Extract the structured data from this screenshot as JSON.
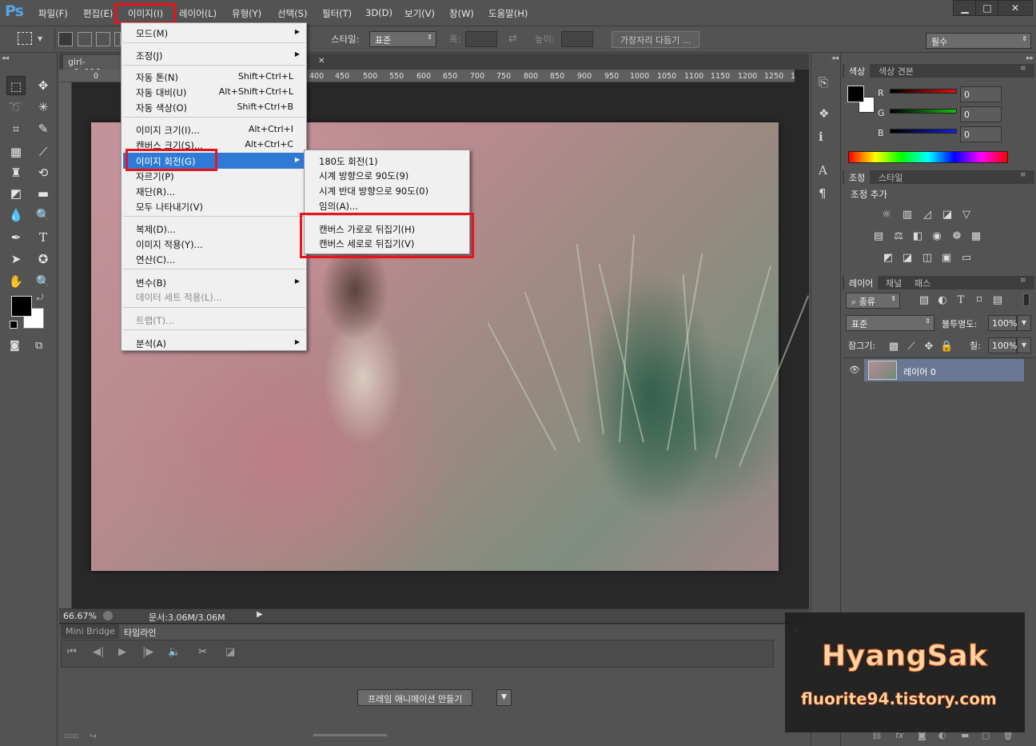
{
  "app": {
    "logo": "Ps"
  },
  "menubar": {
    "items": [
      "파일(F)",
      "편집(E)",
      "이미지(I)",
      "레이어(L)",
      "유형(Y)",
      "선택(S)",
      "필터(T)",
      "3D(D)",
      "보기(V)",
      "창(W)",
      "도움말(H)"
    ],
    "window_controls": [
      "minimize-icon",
      "maximize-icon",
      "close-icon"
    ]
  },
  "options": {
    "style_label": "스타일:",
    "style_value": "표준",
    "width_label": "폭:",
    "height_label": "높이:",
    "refine_button": "가장자리 다듬기 ...",
    "workspace": "필수"
  },
  "document": {
    "tab_title": "girl-g8c996e",
    "ruler_ticks": [
      "0",
      "400",
      "450",
      "500",
      "550",
      "600",
      "650",
      "700",
      "750",
      "800",
      "850",
      "900",
      "950",
      "1000",
      "1050",
      "1100",
      "1150",
      "1200",
      "1250",
      "1"
    ],
    "zoom": "66.67%",
    "doc_size": "문서:3.06M/3.06M"
  },
  "image_menu": {
    "items": [
      {
        "label": "모드(M)",
        "submenu": true
      },
      {
        "label": "조정(J)",
        "submenu": true
      },
      {
        "label": "자동 톤(N)",
        "shortcut": "Shift+Ctrl+L"
      },
      {
        "label": "자동 대비(U)",
        "shortcut": "Alt+Shift+Ctrl+L"
      },
      {
        "label": "자동 색상(O)",
        "shortcut": "Shift+Ctrl+B"
      },
      {
        "label": "이미지 크기(I)...",
        "shortcut": "Alt+Ctrl+I"
      },
      {
        "label": "캔버스 크기(S)...",
        "shortcut": "Alt+Ctrl+C"
      },
      {
        "label": "이미지 회전(G)",
        "submenu": true,
        "highlighted": true
      },
      {
        "label": "자르기(P)"
      },
      {
        "label": "재단(R)..."
      },
      {
        "label": "모두 나타내기(V)"
      },
      {
        "label": "복제(D)..."
      },
      {
        "label": "이미지 적용(Y)..."
      },
      {
        "label": "연산(C)..."
      },
      {
        "label": "변수(B)",
        "submenu": true
      },
      {
        "label": "데이터 세트 적용(L)...",
        "disabled": true
      },
      {
        "label": "트랩(T)...",
        "disabled": true
      },
      {
        "label": "분석(A)",
        "submenu": true
      }
    ]
  },
  "rotate_submenu": {
    "items": [
      "180도 회전(1)",
      "시계 방향으로 90도(9)",
      "시계 반대 방향으로 90도(0)",
      "임의(A)...",
      "캔버스 가로로 뒤집기(H)",
      "캔버스 세로로 뒤집기(V)"
    ]
  },
  "timeline": {
    "tabs": [
      "Mini Bridge",
      "타임라인"
    ],
    "create_button": "프레임 애니메이션 만들기"
  },
  "color_panel": {
    "tabs": [
      "색상",
      "색상 견본"
    ],
    "channels": [
      {
        "name": "R",
        "value": "0",
        "color": "#e01010"
      },
      {
        "name": "G",
        "value": "0",
        "color": "#10c010"
      },
      {
        "name": "B",
        "value": "0",
        "color": "#1020e0"
      }
    ]
  },
  "adjust_panel": {
    "tabs": [
      "조정",
      "스타일"
    ],
    "title": "조정 추가"
  },
  "layers_panel": {
    "tabs": [
      "레이어",
      "채널",
      "패스"
    ],
    "filter": "종류",
    "blend_mode": "표준",
    "opacity_label": "불투명도:",
    "opacity": "100%",
    "lock_label": "잠그기:",
    "fill_label": "칠:",
    "fill": "100%",
    "layers": [
      {
        "name": "레이어 0"
      }
    ]
  },
  "watermark": {
    "title": "HyangSak",
    "url": "fluorite94.tistory.com"
  }
}
